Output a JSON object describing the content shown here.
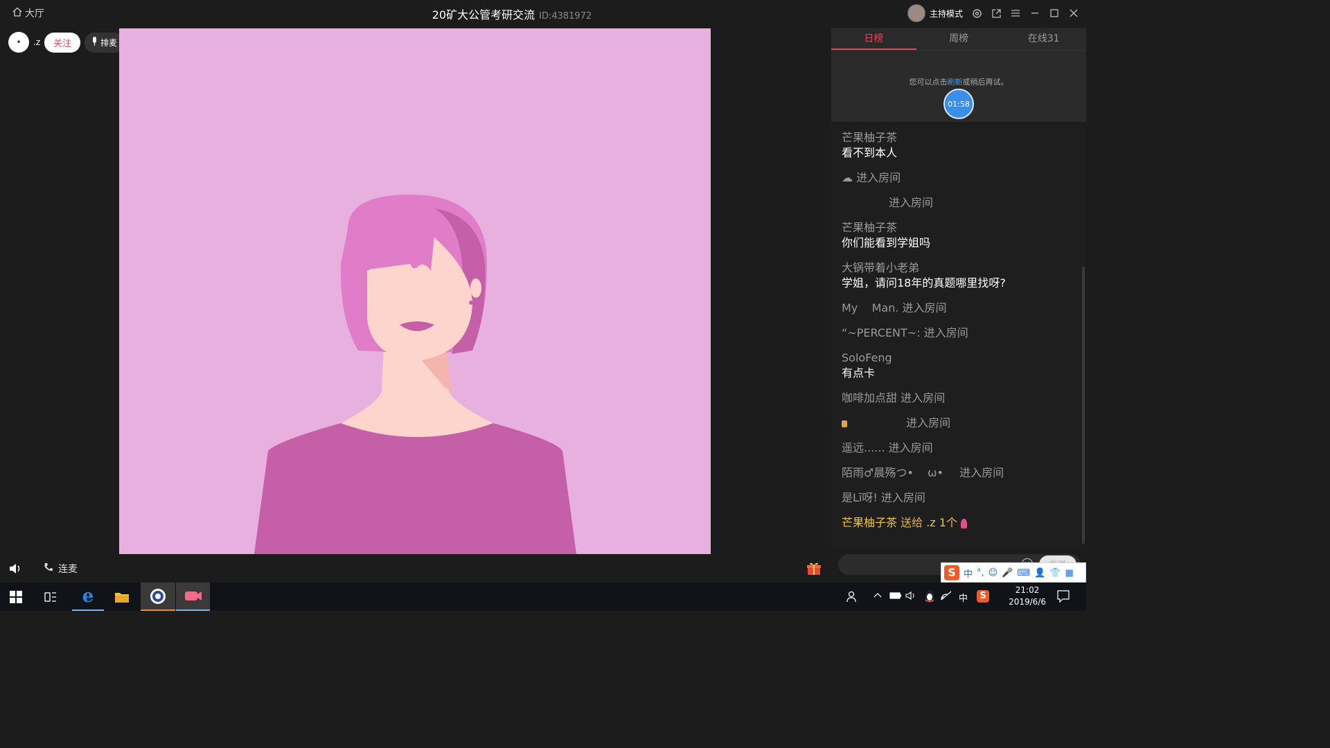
{
  "titlebar": {
    "home_label": "大厅",
    "room_title": "20矿大公管考研交流",
    "room_id": "ID:4381972",
    "host_mode_label": "主持模式"
  },
  "host": {
    "avatar_text": "•",
    "name": ".z",
    "follow_label": "关注",
    "queue_label": "排麦"
  },
  "controls": {
    "lianmai_label": "连麦"
  },
  "rank_panel": {
    "tabs": [
      {
        "label": "日榜",
        "active": true
      },
      {
        "label": "周榜",
        "active": false
      },
      {
        "label": "在线31",
        "active": false
      }
    ],
    "hint_prefix": "您可以点击",
    "hint_link": "刷新",
    "hint_suffix": "或稍后再试。",
    "timer": "01:58"
  },
  "chat": {
    "messages": [
      {
        "user": "芒果柚子茶",
        "text": "看不到本人"
      },
      {
        "user": "☁",
        "text": "进入房间"
      },
      {
        "user": "",
        "text": "进入房间"
      },
      {
        "user": "芒果柚子茶",
        "text": "你们能看到学姐吗"
      },
      {
        "user": "大锅带着小老弟",
        "text": "学姐，请问18年的真题哪里找呀?"
      },
      {
        "user": "My    Man.",
        "text": "进入房间"
      },
      {
        "user": "“~PERCENT~:",
        "text": "进入房间"
      },
      {
        "user": "SoloFeng",
        "text": "有点卡"
      },
      {
        "user": "咖啡加点甜",
        "text": "进入房间"
      },
      {
        "user": "",
        "text": "进入房间"
      },
      {
        "user": "遥远......",
        "text": "进入房间"
      },
      {
        "user": "陌雨♂晨殇つ•    ω•",
        "text": "进入房间"
      },
      {
        "user": "是Lī呀!",
        "text": "进入房间"
      }
    ],
    "gift_message": {
      "user": "芒果柚子茶",
      "verb": "送给",
      "target": ".z 1个"
    },
    "send_label": "发送"
  },
  "ime": {
    "items": [
      "中",
      "°,",
      "☺",
      "🎤",
      "⌨",
      "👤",
      "👕",
      "▦"
    ]
  },
  "taskbar": {
    "time": "21:02",
    "date": "2019/6/6",
    "ime_lang": "中"
  },
  "colors": {
    "accent": "#e8415a",
    "stage_bg": "#e8b0df",
    "hair": "#e07cc8",
    "shirt": "#c45fa8",
    "skin": "#fdd5cd"
  }
}
